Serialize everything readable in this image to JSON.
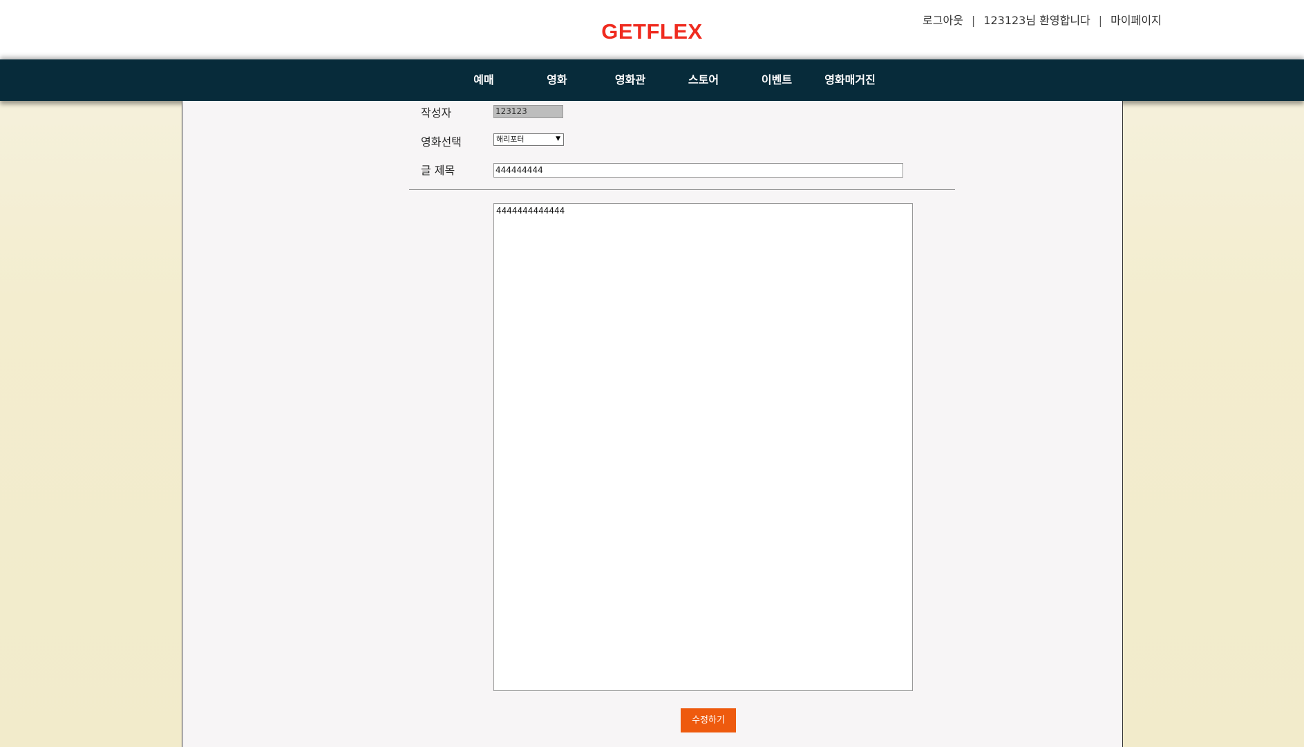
{
  "header": {
    "logo": "GETFLEX",
    "logout": "로그아웃",
    "separator": "|",
    "welcome": "123123님 환영합니다",
    "mypage": "마이페이지"
  },
  "nav": {
    "items": [
      {
        "label": "예매"
      },
      {
        "label": "영화"
      },
      {
        "label": "영화관"
      },
      {
        "label": "스토어"
      },
      {
        "label": "이벤트"
      },
      {
        "label": "영화매거진"
      }
    ]
  },
  "form": {
    "writer_label": "작성자",
    "writer_value": "123123",
    "movie_label": "영화선택",
    "movie_value": "해리포터",
    "title_label": "글 제목",
    "title_value": "444444444",
    "body_value": "4444444444444",
    "submit_label": "수정하기"
  },
  "colors": {
    "logo": "#ef2b1f",
    "navbar": "#072b3a",
    "submit_button": "#ee5a0e",
    "page_background": "#f3edcf",
    "content_background": "#f7f5f6"
  }
}
